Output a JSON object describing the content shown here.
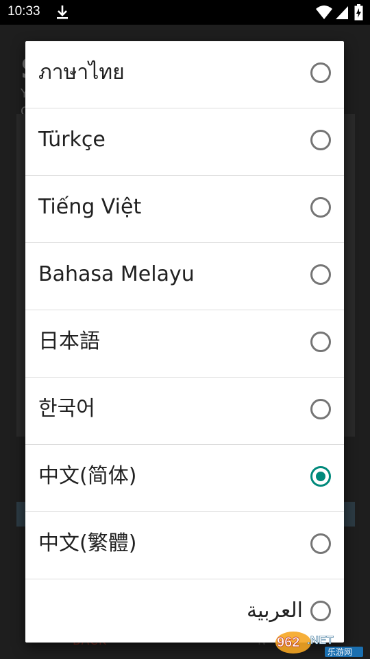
{
  "status_bar": {
    "time": "10:33",
    "icons": [
      "download-icon",
      "wifi-icon",
      "signal-icon",
      "battery-icon"
    ]
  },
  "background_app": {
    "title": "S",
    "subtitle_line1": "Y",
    "subtitle_line2": "C",
    "back_button": "BACK",
    "next_button": "N"
  },
  "dialog": {
    "options": [
      {
        "label": "ภาษาไทย",
        "selected": false
      },
      {
        "label": "Türkçe",
        "selected": false
      },
      {
        "label": "Tiếng Việt",
        "selected": false
      },
      {
        "label": "Bahasa Melayu",
        "selected": false
      },
      {
        "label": "日本語",
        "selected": false
      },
      {
        "label": "한국어",
        "selected": false
      },
      {
        "label": "中文(简体)",
        "selected": true
      },
      {
        "label": "中文(繁體)",
        "selected": false
      },
      {
        "label": "العربية",
        "selected": false
      }
    ]
  },
  "watermark": {
    "text": "962.NET",
    "subtext": "乐游网"
  },
  "colors": {
    "accent": "#00897b",
    "radio_unchecked": "#757575"
  }
}
